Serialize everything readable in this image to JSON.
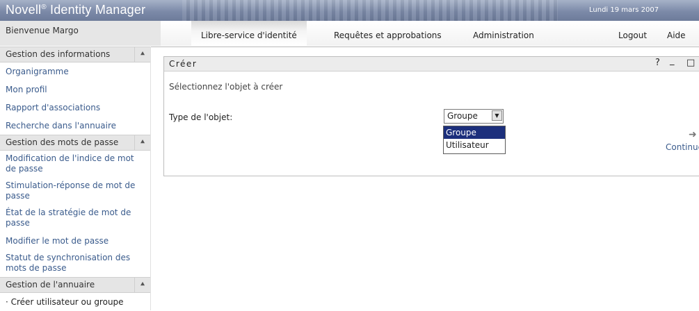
{
  "brand": {
    "name": "Novell",
    "reg": "®",
    "product": " Identity Manager"
  },
  "date": "Lundi 19 mars 2007",
  "welcome": "Bienvenue Margo",
  "tabs": [
    {
      "label": "Libre-service d'identité",
      "active": true
    },
    {
      "label": "Requêtes et approbations",
      "active": false
    },
    {
      "label": "Administration",
      "active": false
    },
    {
      "label": "Logout",
      "active": false
    },
    {
      "label": "Aide",
      "active": false
    }
  ],
  "sidebar": {
    "sections": [
      {
        "title": "Gestion des informations",
        "items": [
          "Organigramme",
          "Mon profil",
          "Rapport d'associations",
          "Recherche dans l'annuaire"
        ]
      },
      {
        "title": "Gestion des mots de passe",
        "items": [
          "Modification de l'indice de mot de passe",
          "Stimulation-réponse de mot de passe",
          "État de la stratégie de mot de passe",
          "Modifier le mot de passe",
          "Statut de synchronisation des mots de passe"
        ]
      },
      {
        "title": "Gestion de l'annuaire",
        "items": [
          "· Créer utilisateur ou groupe"
        ]
      }
    ]
  },
  "panel": {
    "title": "Créer",
    "help": "?",
    "minimize": "_",
    "maximize": "□",
    "instruction": "Sélectionnez l'objet à créer",
    "type_label": "Type de l'objet:",
    "select_value": "Groupe",
    "options": [
      "Groupe",
      "Utilisateur"
    ],
    "selected_option": "Groupe",
    "continue_label": "Continuer"
  }
}
